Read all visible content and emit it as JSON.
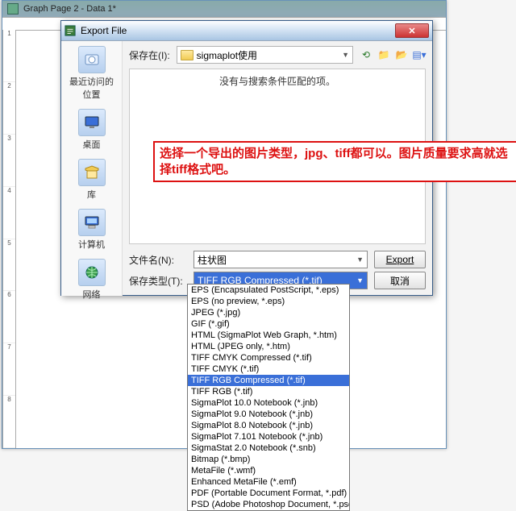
{
  "bg_window": {
    "title": "Graph Page 2 - Data 1*"
  },
  "dialog": {
    "title": "Export File",
    "saveIn_label": "保存在(I):",
    "location": "sigmaplot使用",
    "empty_text": "没有与搜索条件匹配的项。",
    "filename_label": "文件名(N):",
    "filename_value": "柱状图",
    "filetype_label": "保存类型(T):",
    "filetype_value": "TIFF RGB Compressed (*.tif)",
    "export_btn": "Export",
    "cancel_btn": "取消",
    "places": {
      "recent": "最近访问的位置",
      "desktop": "桌面",
      "library": "库",
      "computer": "计算机",
      "network": "网络"
    }
  },
  "dropdown": [
    "EPS (Encapsulated PostScript, *.eps)",
    "EPS (no preview, *.eps)",
    "JPEG (*.jpg)",
    "GIF (*.gif)",
    "HTML (SigmaPlot Web Graph, *.htm)",
    "HTML (JPEG only, *.htm)",
    "TIFF CMYK Compressed (*.tif)",
    "TIFF CMYK (*.tif)",
    "TIFF RGB Compressed (*.tif)",
    "TIFF RGB (*.tif)",
    "SigmaPlot 10.0 Notebook (*.jnb)",
    "SigmaPlot 9.0 Notebook (*.jnb)",
    "SigmaPlot 8.0 Notebook (*.jnb)",
    "SigmaPlot 7.101 Notebook (*.jnb)",
    "SigmaStat 2.0 Notebook (*.snb)",
    "Bitmap (*.bmp)",
    "MetaFile (*.wmf)",
    "Enhanced MetaFile (*.emf)",
    "PDF (Portable Document Format, *.pdf)",
    "PSD (Adobe Photoshop Document, *.psd)"
  ],
  "dropdown_selected_index": 8,
  "annotation": "选择一个导出的图片类型，jpg、tiff都可以。图片质量要求高就选择tiff格式吧。"
}
